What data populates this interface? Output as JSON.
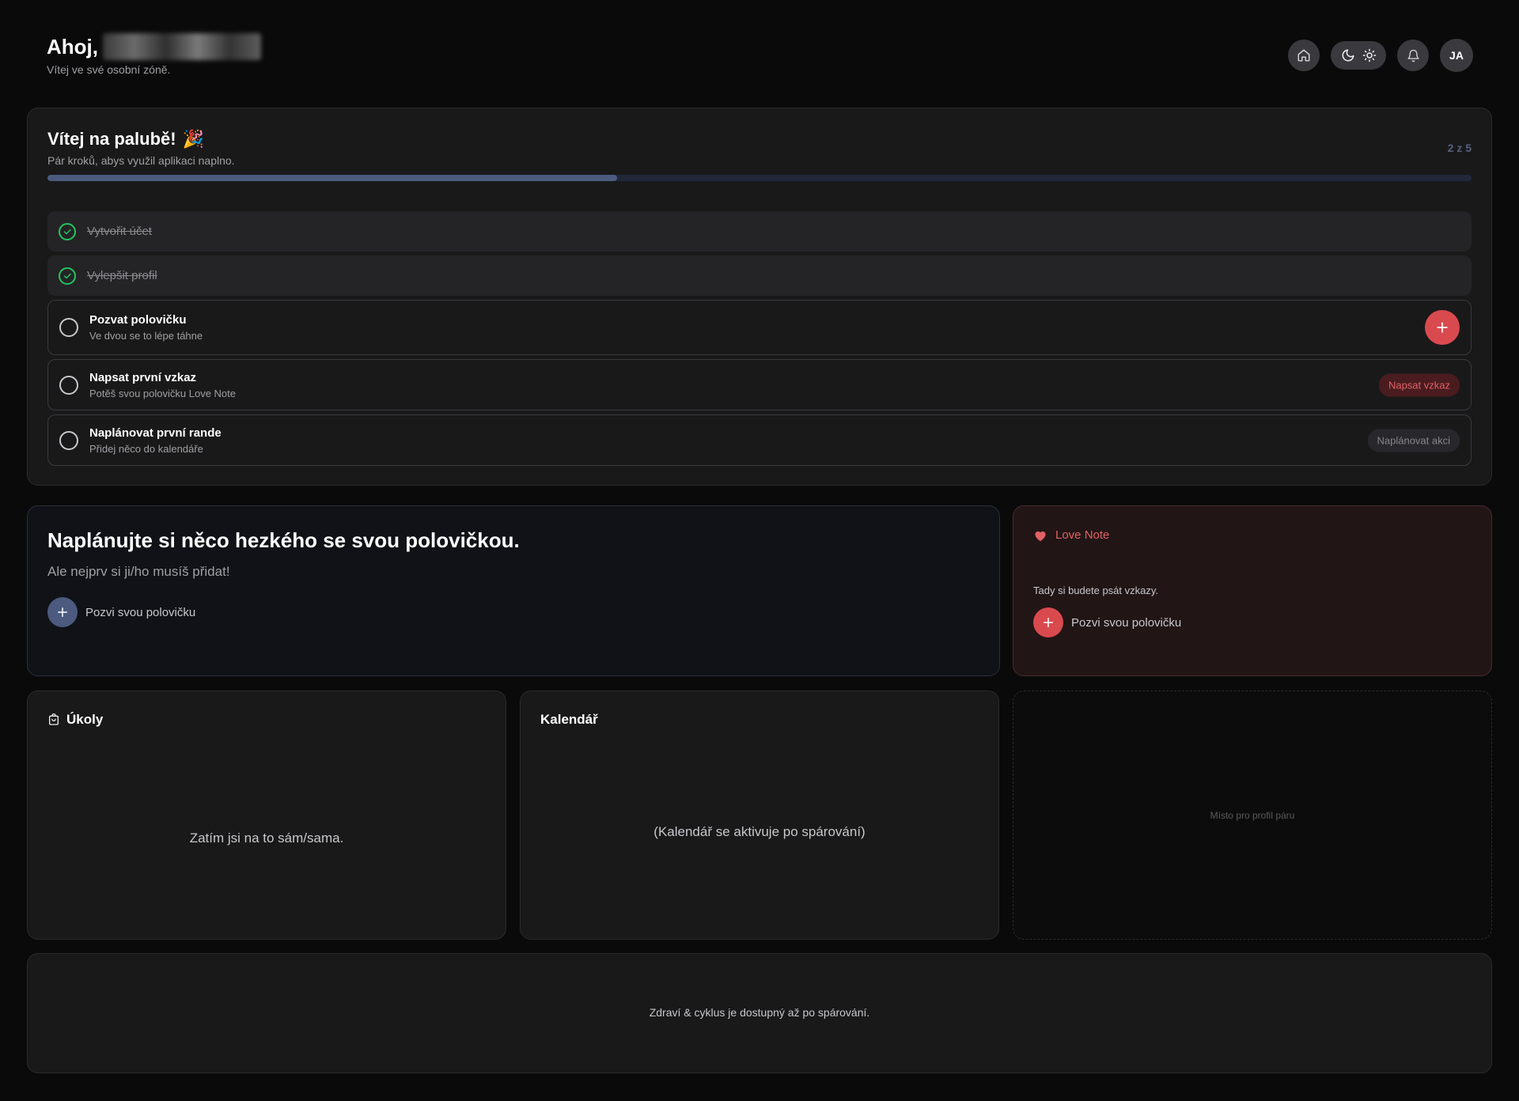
{
  "header": {
    "greeting": "Ahoj,",
    "subtitle": "Vítej ve své osobní zóně.",
    "avatar_initials": "JA"
  },
  "onboarding": {
    "title": "Vítej na palubě!",
    "title_emoji": "🎉",
    "subtitle": "Pár kroků, abys využil aplikaci naplno.",
    "progress_text": "2 z 5",
    "progress_fraction": 0.4,
    "steps": [
      {
        "label": "Vytvořit účet",
        "done": true
      },
      {
        "label": "Vylepšit profil",
        "done": true
      },
      {
        "label": "Pozvat polovičku",
        "desc": "Ve dvou se to lépe táhne",
        "action": "+"
      },
      {
        "label": "Napsat první vzkaz",
        "desc": "Potěš svou polovičku Love Note",
        "action": "Napsat vzkaz"
      },
      {
        "label": "Naplánovat první rande",
        "desc": "Přidej něco do kalendáře",
        "action": "Naplánovat akci"
      }
    ]
  },
  "plan": {
    "title": "Naplánujte si něco hezkého se svou polovičkou.",
    "subtitle": "Ale nejprv si ji/ho musíš přidat!",
    "invite_label": "Pozvi svou polovičku"
  },
  "love_note": {
    "title": "Love Note",
    "text": "Tady si budete psát vzkazy.",
    "invite_label": "Pozvi svou polovičku"
  },
  "tasks": {
    "title": "Úkoly",
    "empty": "Zatím jsi na to sám/sama."
  },
  "calendar": {
    "title": "Kalendář",
    "empty": "(Kalendář se aktivuje po spárování)"
  },
  "couple_profile": {
    "placeholder": "Místo pro profil páru"
  },
  "health": {
    "message": "Zdraví & cyklus je dostupný až po spárování."
  },
  "colors": {
    "accent_red": "#d94a4f",
    "accent_blue": "#4b5a7e",
    "success_green": "#22c55e",
    "background": "#0a0a0b"
  }
}
